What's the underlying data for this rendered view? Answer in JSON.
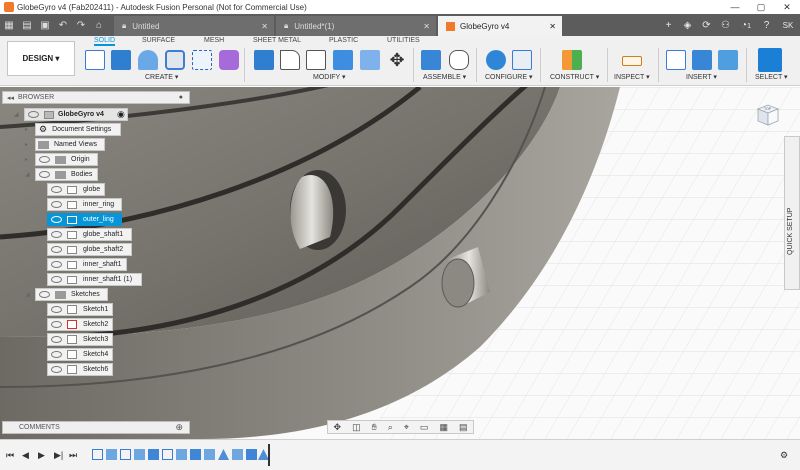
{
  "window": {
    "title": "GlobeGyro v4 (Fab202411) - Autodesk Fusion Personal (Not for Commercial Use)",
    "buttons": [
      "—",
      "▢",
      "✕"
    ]
  },
  "tabs": [
    {
      "label": "Untitled",
      "active": false
    },
    {
      "label": "Untitled*(1)",
      "active": false
    },
    {
      "label": "GlobeGyro v4",
      "active": true
    }
  ],
  "tab_right": {
    "notifications": "1",
    "user": "SK"
  },
  "toolbar": {
    "workspace": "DESIGN ▾",
    "tabs": [
      "SOLID",
      "SURFACE",
      "MESH",
      "SHEET METAL",
      "PLASTIC",
      "UTILITIES"
    ],
    "groups": [
      "CREATE ▾",
      "MODIFY ▾",
      "ASSEMBLE ▾",
      "CONFIGURE ▾",
      "CONSTRUCT ▾",
      "INSPECT ▾",
      "INSERT ▾",
      "SELECT ▾"
    ]
  },
  "browser": {
    "title": "BROWSER",
    "root": "GlobeGyro v4",
    "items": [
      {
        "label": "Document Settings",
        "kind": "gear"
      },
      {
        "label": "Named Views",
        "kind": "folder"
      },
      {
        "label": "Origin",
        "kind": "folder"
      },
      {
        "label": "Bodies",
        "kind": "folder"
      },
      {
        "label": "globe",
        "kind": "body"
      },
      {
        "label": "inner_ring",
        "kind": "body"
      },
      {
        "label": "outer_ling",
        "kind": "body",
        "selected": true
      },
      {
        "label": "globe_shaft1",
        "kind": "body"
      },
      {
        "label": "globe_shaft2",
        "kind": "body"
      },
      {
        "label": "inner_shaft1",
        "kind": "body"
      },
      {
        "label": "inner_shaft1 (1)",
        "kind": "body"
      },
      {
        "label": "Sketches",
        "kind": "folder"
      },
      {
        "label": "Sketch1",
        "kind": "sketch"
      },
      {
        "label": "Sketch2",
        "kind": "sketch"
      },
      {
        "label": "Sketch3",
        "kind": "sketch"
      },
      {
        "label": "Sketch4",
        "kind": "sketch"
      },
      {
        "label": "Sketch6",
        "kind": "sketch"
      }
    ]
  },
  "comments": {
    "title": "COMMENTS"
  },
  "quick_setup": "QUICK SETUP",
  "viewcube": "TOP",
  "colors": {
    "accent": "#0696d7",
    "tab_bg": "#5c5c5c",
    "orange": "#f07a28"
  }
}
